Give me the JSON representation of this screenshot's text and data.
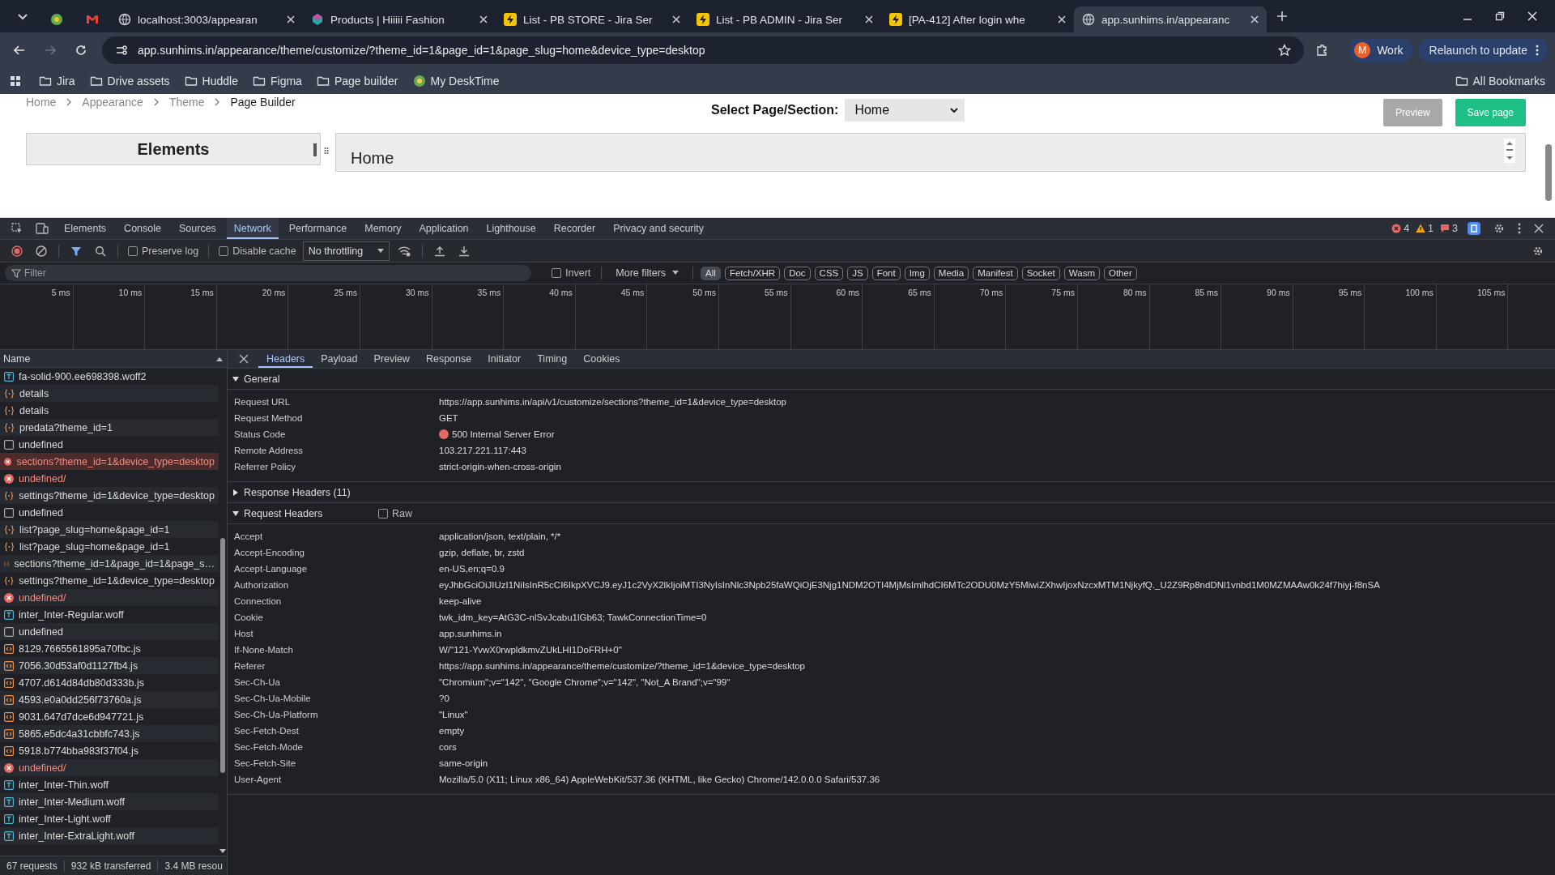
{
  "browser": {
    "tabs": [
      {
        "kind": "pinned",
        "selected": false
      },
      {
        "kind": "mail",
        "selected": false
      },
      {
        "kind": "page",
        "title": "localhost:3003/appearan",
        "selected": false
      },
      {
        "kind": "shop",
        "title": "Products | Hiiiii Fashion",
        "selected": false
      },
      {
        "kind": "jira",
        "title": "List - PB STORE - Jira Ser",
        "selected": false
      },
      {
        "kind": "jira",
        "title": "List - PB ADMIN - Jira Ser",
        "selected": false
      },
      {
        "kind": "jira",
        "title": "[PA-412] After login whe",
        "selected": false
      },
      {
        "kind": "page",
        "title": "app.sunhims.in/appearanc",
        "selected": true
      }
    ],
    "address": "app.sunhims.in/appearance/theme/customize/?theme_id=1&page_id=1&page_slug=home&device_type=desktop",
    "profile": {
      "initial": "M",
      "label": "Work"
    },
    "relaunch": "Relaunch to update",
    "bookmarks": [
      {
        "kind": "folder",
        "label": "Jira"
      },
      {
        "kind": "folder",
        "label": "Drive assets"
      },
      {
        "kind": "folder",
        "label": "Huddle"
      },
      {
        "kind": "folder",
        "label": "Figma"
      },
      {
        "kind": "folder",
        "label": "Page builder"
      },
      {
        "kind": "site",
        "label": "My DeskTime"
      }
    ],
    "all_bookmarks": "All Bookmarks"
  },
  "page": {
    "breadcrumb": [
      "Home",
      "Appearance",
      "Theme",
      "Page Builder"
    ],
    "select_label": "Select Page/Section:",
    "select_value": "Home",
    "buttons": [
      {
        "kind": "secondary",
        "label": "Preview"
      },
      {
        "kind": "primary",
        "label": "Save page"
      }
    ],
    "elements_title": "Elements",
    "canvas_title": "Home"
  },
  "devtools": {
    "tabs": [
      {
        "label": "Elements",
        "selected": false
      },
      {
        "label": "Console",
        "selected": false
      },
      {
        "label": "Sources",
        "selected": false
      },
      {
        "label": "Network",
        "selected": true
      },
      {
        "label": "Performance",
        "selected": false
      },
      {
        "label": "Memory",
        "selected": false
      },
      {
        "label": "Application",
        "selected": false
      },
      {
        "label": "Lighthouse",
        "selected": false
      },
      {
        "label": "Recorder",
        "selected": false
      },
      {
        "label": "Privacy and security",
        "selected": false
      }
    ],
    "counts": [
      {
        "kind": "error",
        "value": "4"
      },
      {
        "kind": "warning",
        "value": "1"
      },
      {
        "kind": "issue",
        "value": "3"
      }
    ],
    "preserve_log": {
      "label": "Preserve log",
      "checked": false
    },
    "disable_cache": {
      "label": "Disable cache",
      "checked": false
    },
    "throttling": "No throttling",
    "filter": {
      "placeholder": "Filter"
    },
    "invert": {
      "label": "Invert",
      "checked": false
    },
    "more_filters": "More filters",
    "type_filters": [
      {
        "label": "All",
        "selected": true
      },
      {
        "label": "Fetch/XHR",
        "selected": false
      },
      {
        "label": "Doc",
        "selected": false
      },
      {
        "label": "CSS",
        "selected": false
      },
      {
        "label": "JS",
        "selected": false
      },
      {
        "label": "Font",
        "selected": false
      },
      {
        "label": "Img",
        "selected": false
      },
      {
        "label": "Media",
        "selected": false
      },
      {
        "label": "Manifest",
        "selected": false
      },
      {
        "label": "Socket",
        "selected": false
      },
      {
        "label": "Wasm",
        "selected": false
      },
      {
        "label": "Other",
        "selected": false
      }
    ],
    "timeline_ticks": [
      "5 ms",
      "10 ms",
      "15 ms",
      "20 ms",
      "25 ms",
      "30 ms",
      "35 ms",
      "40 ms",
      "45 ms",
      "50 ms",
      "55 ms",
      "60 ms",
      "65 ms",
      "70 ms",
      "75 ms",
      "80 ms",
      "85 ms",
      "90 ms",
      "95 ms",
      "100 ms",
      "105 ms"
    ],
    "name_column": "Name",
    "requests": [
      {
        "kind": "font",
        "name": "fa-solid-900.ee698398.woff2",
        "selected": false
      },
      {
        "kind": "fetch",
        "name": "details",
        "selected": false
      },
      {
        "kind": "fetch",
        "name": "details",
        "selected": false
      },
      {
        "kind": "fetch",
        "name": "predata?theme_id=1",
        "selected": false
      },
      {
        "kind": "doc",
        "name": "undefined",
        "selected": false
      },
      {
        "kind": "error",
        "name": "sections?theme_id=1&device_type=desktop",
        "selected": true
      },
      {
        "kind": "error",
        "name": "undefined/",
        "selected": false
      },
      {
        "kind": "fetch",
        "name": "settings?theme_id=1&device_type=desktop",
        "selected": false
      },
      {
        "kind": "doc",
        "name": "undefined",
        "selected": false
      },
      {
        "kind": "fetch",
        "name": "list?page_slug=home&page_id=1",
        "selected": false
      },
      {
        "kind": "fetch",
        "name": "list?page_slug=home&page_id=1",
        "selected": false
      },
      {
        "kind": "fetch",
        "name": "sections?theme_id=1&page_id=1&page_s…",
        "selected": false
      },
      {
        "kind": "fetch",
        "name": "settings?theme_id=1&device_type=desktop",
        "selected": false
      },
      {
        "kind": "error",
        "name": "undefined/",
        "selected": false
      },
      {
        "kind": "font",
        "name": "inter_Inter-Regular.woff",
        "selected": false
      },
      {
        "kind": "doc",
        "name": "undefined",
        "selected": false
      },
      {
        "kind": "script",
        "name": "8129.7665561895a70fbc.js",
        "selected": false
      },
      {
        "kind": "script",
        "name": "7056.30d53af0d1127fb4.js",
        "selected": false
      },
      {
        "kind": "script",
        "name": "4707.d614d84db80d333b.js",
        "selected": false
      },
      {
        "kind": "script",
        "name": "4593.e0a0dd256f73760a.js",
        "selected": false
      },
      {
        "kind": "script",
        "name": "9031.647d7dce6d947721.js",
        "selected": false
      },
      {
        "kind": "script",
        "name": "5865.e5dc4a31cbbfc743.js",
        "selected": false
      },
      {
        "kind": "script",
        "name": "5918.b774bba983f37f04.js",
        "selected": false
      },
      {
        "kind": "error",
        "name": "undefined/",
        "selected": false
      },
      {
        "kind": "font",
        "name": "inter_Inter-Thin.woff",
        "selected": false
      },
      {
        "kind": "font",
        "name": "inter_Inter-Medium.woff",
        "selected": false
      },
      {
        "kind": "font",
        "name": "inter_Inter-Light.woff",
        "selected": false
      },
      {
        "kind": "font",
        "name": "inter_Inter-ExtraLight.woff",
        "selected": false
      }
    ],
    "summary": [
      "67 requests",
      "932 kB transferred",
      "3.4 MB resou"
    ],
    "detail_tabs": [
      {
        "label": "Headers",
        "selected": true
      },
      {
        "label": "Payload",
        "selected": false
      },
      {
        "label": "Preview",
        "selected": false
      },
      {
        "label": "Response",
        "selected": false
      },
      {
        "label": "Initiator",
        "selected": false
      },
      {
        "label": "Timing",
        "selected": false
      },
      {
        "label": "Cookies",
        "selected": false
      }
    ],
    "sections": [
      {
        "title": "General",
        "expanded": true,
        "rows": [
          {
            "name": "Request URL",
            "value": "https://app.sunhims.in/api/v1/customize/sections?theme_id=1&device_type=desktop"
          },
          {
            "name": "Request Method",
            "value": "GET"
          },
          {
            "name": "Status Code",
            "value": "500 Internal Server Error",
            "color": "#e46962"
          },
          {
            "name": "Remote Address",
            "value": "103.217.221.117:443"
          },
          {
            "name": "Referrer Policy",
            "value": "strict-origin-when-cross-origin"
          }
        ]
      },
      {
        "title": "Response Headers (11)",
        "expanded": false
      },
      {
        "title": "Request Headers",
        "expanded": true,
        "raw": {
          "label": "Raw",
          "checked": false
        },
        "rows": [
          {
            "name": "Accept",
            "value": "application/json, text/plain, */*"
          },
          {
            "name": "Accept-Encoding",
            "value": "gzip, deflate, br, zstd"
          },
          {
            "name": "Accept-Language",
            "value": "en-US,en;q=0.9"
          },
          {
            "name": "Authorization",
            "value": "eyJhbGciOiJIUzI1NiIsInR5cCI6IkpXVCJ9.eyJ1c2VyX2lkIjoiMTI3NyIsInNlc3Npb25faWQiOjE3Njg1NDM2OTI4MjMsImlhdCI6MTc2ODU0MzY5MiwiZXhwIjoxNzcxMTM1NjkyfQ._U2Z9Rp8ndDNl1vnbd1M0MZMAAw0k24f7hiyj-f8nSA"
          },
          {
            "name": "Connection",
            "value": "keep-alive"
          },
          {
            "name": "Cookie",
            "value": "twk_idm_key=AtG3C-nlSvJcabu1lGb63; TawkConnectionTime=0"
          },
          {
            "name": "Host",
            "value": "app.sunhims.in"
          },
          {
            "name": "If-None-Match",
            "value": "W/\"121-YvwX0rwpldkmvZUkLHI1DoFRH+0\""
          },
          {
            "name": "Referer",
            "value": "https://app.sunhims.in/appearance/theme/customize/?theme_id=1&device_type=desktop"
          },
          {
            "name": "Sec-Ch-Ua",
            "value": "\"Chromium\";v=\"142\", \"Google Chrome\";v=\"142\", \"Not_A Brand\";v=\"99\""
          },
          {
            "name": "Sec-Ch-Ua-Mobile",
            "value": "?0"
          },
          {
            "name": "Sec-Ch-Ua-Platform",
            "value": "\"Linux\""
          },
          {
            "name": "Sec-Fetch-Dest",
            "value": "empty"
          },
          {
            "name": "Sec-Fetch-Mode",
            "value": "cors"
          },
          {
            "name": "Sec-Fetch-Site",
            "value": "same-origin"
          },
          {
            "name": "User-Agent",
            "value": "Mozilla/5.0 (X11; Linux x86_64) AppleWebKit/537.36 (KHTML, like Gecko) Chrome/142.0.0.0 Safari/537.36"
          }
        ]
      }
    ]
  }
}
